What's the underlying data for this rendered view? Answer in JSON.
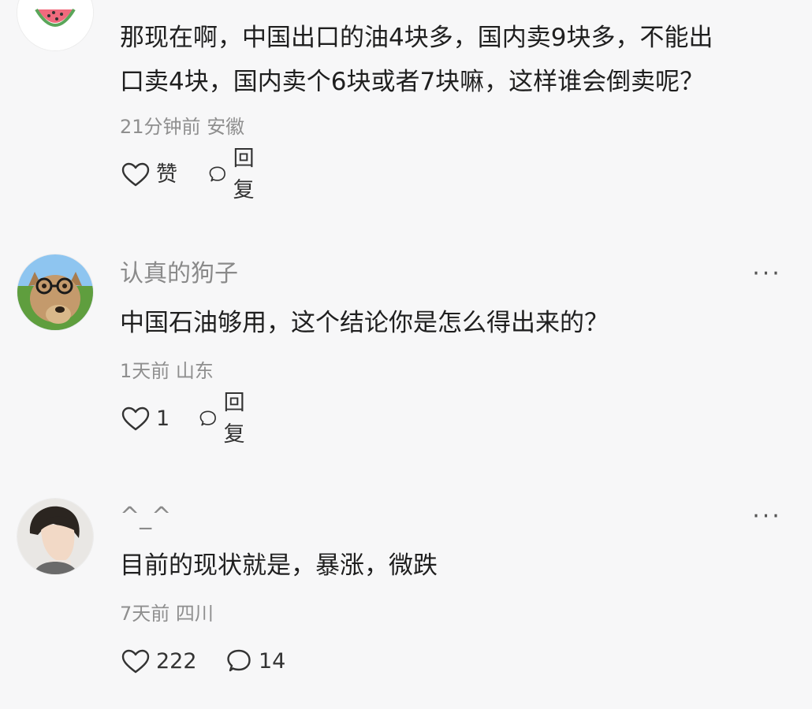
{
  "comments": [
    {
      "avatar": "watermelon-avatar",
      "username": "",
      "text_lines": [
        "那现在啊，中国出口的油4块多，国内卖9块多，不能出",
        "口卖4块，国内卖个6块或者7块嘛，这样谁会倒卖呢？"
      ],
      "time": "21分钟前",
      "location": "安徽",
      "like_label": "赞",
      "reply_label": "回复"
    },
    {
      "avatar": "dog-with-glasses-avatar",
      "username": "认真的狗子",
      "more": "···",
      "text_lines": [
        "中国石油够用，这个结论你是怎么得出来的？"
      ],
      "time": "1天前",
      "location": "山东",
      "like_label": "1",
      "reply_label": "回复"
    },
    {
      "avatar": "young-man-avatar",
      "username": "^_^",
      "more": "···",
      "text_lines": [
        "目前的现状就是，暴涨，微跌"
      ],
      "time": "7天前",
      "location": "四川",
      "like_label": "222",
      "reply_label": "14"
    }
  ],
  "icons": {
    "like": "heart-icon",
    "reply": "comment-bubble-icon",
    "more": "more-icon"
  }
}
